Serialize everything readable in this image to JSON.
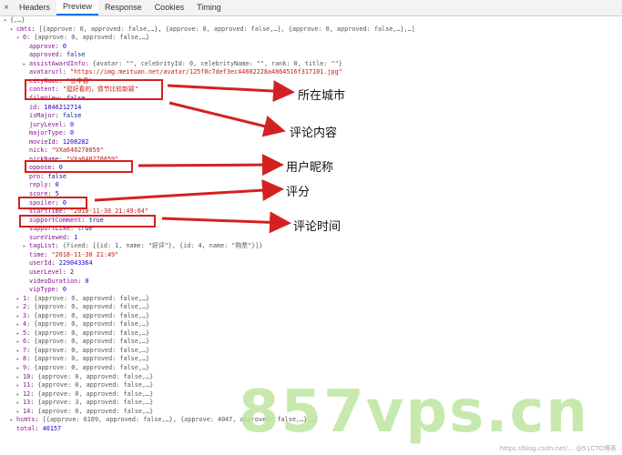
{
  "tabs": {
    "close": "×",
    "items": [
      {
        "label": "Headers",
        "active": false
      },
      {
        "label": "Preview",
        "active": true
      },
      {
        "label": "Response",
        "active": false
      },
      {
        "label": "Cookies",
        "active": false
      },
      {
        "label": "Timing",
        "active": false
      }
    ]
  },
  "lines": [
    {
      "indent": 0,
      "tri": "▾",
      "text": "{,…}"
    },
    {
      "indent": 1,
      "tri": "▾",
      "key": "cmts",
      "preview": "[{approve: 0, approved: false,…}, {approve: 0, approved: false,…}, {approve: 0, approved: false,…},…]"
    },
    {
      "indent": 2,
      "tri": "▾",
      "key": "0",
      "preview": "{approve: 0, approved: false,…}"
    },
    {
      "indent": 3,
      "key": "approve",
      "val": "0",
      "t": "num"
    },
    {
      "indent": 3,
      "key": "approved",
      "val": "false",
      "t": "bool"
    },
    {
      "indent": 3,
      "tri": "▸",
      "key": "assistAwardInfo",
      "preview": "{avatar: \"\", celebrityId: 0, celebrityName: \"\", rank: 0, title: \"\"}"
    },
    {
      "indent": 3,
      "key": "avatarurl",
      "val": "\"https://img.meituan.net/avatar/125f0c7def3ec44082228a4864516f317101.jpg\"",
      "t": "str"
    },
    {
      "indent": 3,
      "key": "cityName",
      "val": "\"长丰县\"",
      "t": "str"
    },
    {
      "indent": 3,
      "key": "content",
      "val": "\"挺好看的，情节比较新颖\"",
      "t": "str"
    },
    {
      "indent": 3,
      "key": "filmView",
      "val": "false",
      "t": "bool"
    },
    {
      "indent": 3,
      "key": "id",
      "val": "1046212714",
      "t": "num"
    },
    {
      "indent": 3,
      "key": "isMajor",
      "val": "false",
      "t": "bool"
    },
    {
      "indent": 3,
      "key": "juryLevel",
      "val": "0",
      "t": "num"
    },
    {
      "indent": 3,
      "key": "majorType",
      "val": "0",
      "t": "num"
    },
    {
      "indent": 3,
      "key": "movieId",
      "val": "1208282",
      "t": "num"
    },
    {
      "indent": 3,
      "key": "nick",
      "val": "\"VXa640270859\"",
      "t": "str"
    },
    {
      "indent": 3,
      "key": "nickName",
      "val": "\"VXa640270859\"",
      "t": "str"
    },
    {
      "indent": 3,
      "key": "oppose",
      "val": "0",
      "t": "num"
    },
    {
      "indent": 3,
      "key": "pro",
      "val": "false",
      "t": "bool"
    },
    {
      "indent": 3,
      "key": "reply",
      "val": "0",
      "t": "num"
    },
    {
      "indent": 3,
      "key": "score",
      "val": "5",
      "t": "num"
    },
    {
      "indent": 3,
      "key": "spoiler",
      "val": "0",
      "t": "num"
    },
    {
      "indent": 3,
      "key": "startTime",
      "val": "\"2018-11-30 21:49:04\"",
      "t": "str"
    },
    {
      "indent": 3,
      "key": "supportComment",
      "val": "true",
      "t": "bool"
    },
    {
      "indent": 3,
      "key": "supportLike",
      "val": "true",
      "t": "bool"
    },
    {
      "indent": 3,
      "key": "sureViewed",
      "val": "1",
      "t": "num"
    },
    {
      "indent": 3,
      "tri": "▸",
      "key": "tagList",
      "preview": "{fixed: [{id: 1, name: \"好评\"}, {id: 4, name: \"购票\"}]}"
    },
    {
      "indent": 3,
      "key": "time",
      "val": "\"2018-11-30 21:49\"",
      "t": "str"
    },
    {
      "indent": 3,
      "key": "userId",
      "val": "229043364",
      "t": "num"
    },
    {
      "indent": 3,
      "key": "userLevel",
      "val": "2",
      "t": "num"
    },
    {
      "indent": 3,
      "key": "videoDuration",
      "val": "0",
      "t": "num"
    },
    {
      "indent": 3,
      "key": "vipType",
      "val": "0",
      "t": "num"
    },
    {
      "indent": 2,
      "tri": "▸",
      "key": "1",
      "preview": "{approve: 0, approved: false,…}"
    },
    {
      "indent": 2,
      "tri": "▸",
      "key": "2",
      "preview": "{approve: 0, approved: false,…}"
    },
    {
      "indent": 2,
      "tri": "▸",
      "key": "3",
      "preview": "{approve: 0, approved: false,…}"
    },
    {
      "indent": 2,
      "tri": "▸",
      "key": "4",
      "preview": "{approve: 0, approved: false,…}"
    },
    {
      "indent": 2,
      "tri": "▸",
      "key": "5",
      "preview": "{approve: 0, approved: false,…}"
    },
    {
      "indent": 2,
      "tri": "▸",
      "key": "6",
      "preview": "{approve: 0, approved: false,…}"
    },
    {
      "indent": 2,
      "tri": "▸",
      "key": "7",
      "preview": "{approve: 0, approved: false,…}"
    },
    {
      "indent": 2,
      "tri": "▸",
      "key": "8",
      "preview": "{approve: 0, approved: false,…}"
    },
    {
      "indent": 2,
      "tri": "▸",
      "key": "9",
      "preview": "{approve: 0, approved: false,…}"
    },
    {
      "indent": 2,
      "tri": "▸",
      "key": "10",
      "preview": "{approve: 0, approved: false,…}"
    },
    {
      "indent": 2,
      "tri": "▸",
      "key": "11",
      "preview": "{approve: 0, approved: false,…}"
    },
    {
      "indent": 2,
      "tri": "▸",
      "key": "12",
      "preview": "{approve: 0, approved: false,…}"
    },
    {
      "indent": 2,
      "tri": "▸",
      "key": "13",
      "preview": "{approve: 3, approved: false,…}"
    },
    {
      "indent": 2,
      "tri": "▸",
      "key": "14",
      "preview": "{approve: 0, approved: false,…}"
    },
    {
      "indent": 1,
      "tri": "▸",
      "key": "hcmts",
      "preview": "[{approve: 6109, approved: false,…}, {approve: 4047, approved: false,…},…]"
    },
    {
      "indent": 1,
      "key": "total",
      "val": "40157",
      "t": "num"
    }
  ],
  "annotations": [
    {
      "label": "所在城市"
    },
    {
      "label": "评论内容"
    },
    {
      "label": "用户昵称"
    },
    {
      "label": "评分"
    },
    {
      "label": "评论时间"
    }
  ],
  "watermark": "857vps.cn",
  "credit": "https://blog.csdn.net/... @51CTO博客",
  "colors": {
    "highlight": "#d32121",
    "watermark": "#bfe6a0",
    "active_tab": "#1a73e8"
  }
}
